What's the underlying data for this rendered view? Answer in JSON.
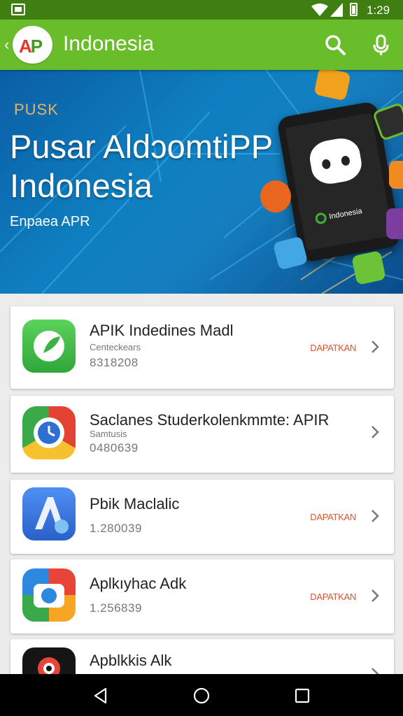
{
  "status_bar": {
    "time": "1:29"
  },
  "app_bar": {
    "logo_text": "AP",
    "title": "Indonesia",
    "icons": [
      "back-arrow-icon",
      "search-icon",
      "mic-icon"
    ]
  },
  "hero": {
    "kicker": "PUSK",
    "title_line1": "Pusar AldɔomtiPP",
    "title_line2": "Indonesia",
    "subtitle": "Enpaea APR",
    "device_label": "Indonesia"
  },
  "apps": [
    {
      "name": "APIK Indedines Madl",
      "sub": "Centeckears",
      "size": "8318208",
      "action": "DAPATKAN",
      "icon": "green-leaf-icon"
    },
    {
      "name": "Saclanes Studerkolenkmmte: APIR",
      "sub": "Samtusis",
      "size": "0480639",
      "action": "",
      "icon": "chrome-style-icon"
    },
    {
      "name": "Pbik Maclalic",
      "sub": "",
      "size": "1.280039",
      "action": "DAPATKAN",
      "icon": "blue-a-icon"
    },
    {
      "name": "Aplkıyhac Adk",
      "sub": "",
      "size": "1.256839",
      "action": "DAPATKAN",
      "icon": "camera-app-icon"
    },
    {
      "name": "Apblkkis Alk",
      "sub": "",
      "size": "",
      "action": "",
      "icon": "dark-camera-icon"
    }
  ],
  "nav_bar": {
    "icons": [
      "back-icon",
      "home-icon",
      "recents-icon"
    ]
  },
  "colors": {
    "status_bar": "#3f7f11",
    "app_bar": "#6abd2a",
    "accent_action": "#e0522b",
    "hero_blue": "#0e7fc0"
  }
}
